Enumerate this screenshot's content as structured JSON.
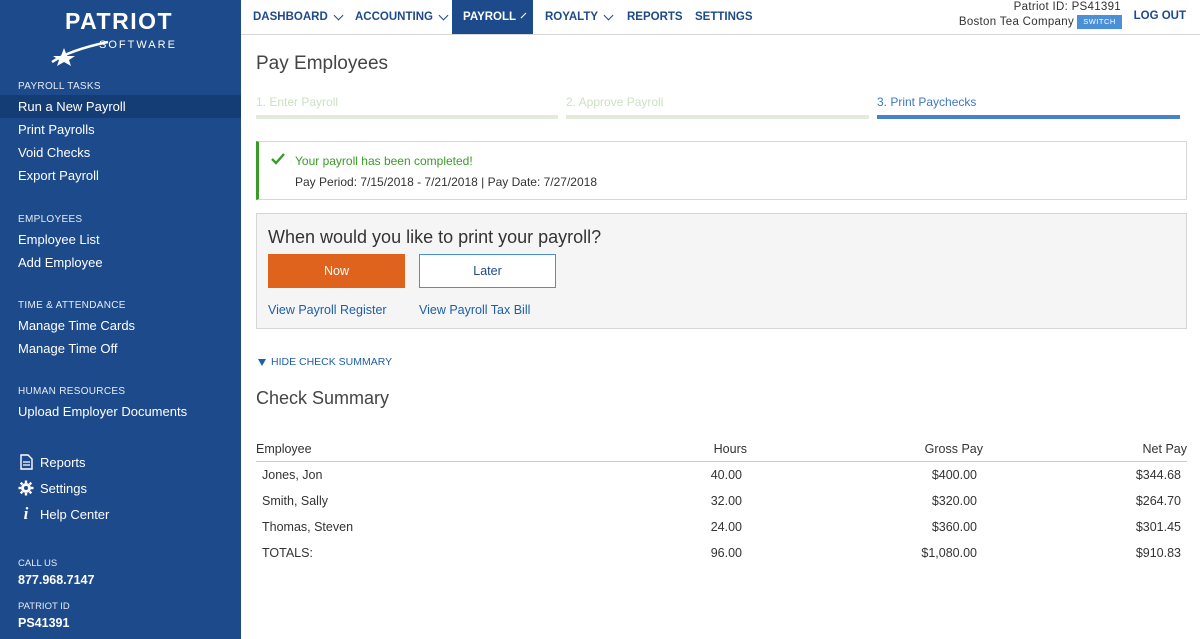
{
  "brand": {
    "name": "PATRIOT",
    "tagline": "SOFTWARE"
  },
  "sidebar": {
    "sections": [
      {
        "title": "PAYROLL TASKS",
        "items": [
          "Run a New Payroll",
          "Print Payrolls",
          "Void Checks",
          "Export Payroll"
        ]
      },
      {
        "title": "EMPLOYEES",
        "items": [
          "Employee List",
          "Add Employee"
        ]
      },
      {
        "title": "TIME & ATTENDANCE",
        "items": [
          "Manage Time Cards",
          "Manage Time Off"
        ]
      },
      {
        "title": "HUMAN RESOURCES",
        "items": [
          "Upload Employer Documents"
        ]
      }
    ],
    "active_item": "Run a New Payroll",
    "links": [
      {
        "label": "Reports",
        "icon": "document-icon"
      },
      {
        "label": "Settings",
        "icon": "gear-icon"
      },
      {
        "label": "Help Center",
        "icon": "info-icon"
      }
    ],
    "call_us_label": "CALL US",
    "phone": "877.968.7147",
    "patriot_id_label": "PATRIOT ID",
    "patriot_id": "PS41391"
  },
  "topnav": {
    "items": [
      {
        "label": "DASHBOARD",
        "dropdown": true
      },
      {
        "label": "ACCOUNTING",
        "dropdown": true
      },
      {
        "label": "PAYROLL",
        "dropdown": true,
        "active": true
      },
      {
        "label": "ROYALTY",
        "dropdown": true
      },
      {
        "label": "REPORTS",
        "dropdown": false
      },
      {
        "label": "SETTINGS",
        "dropdown": false
      }
    ],
    "patriot_id_text": "Patriot ID: PS41391",
    "company": "Boston Tea Company",
    "switch_label": "SWITCH",
    "logout_label": "LOG OUT"
  },
  "main": {
    "title": "Pay Employees",
    "steps": [
      {
        "label": "1. Enter Payroll",
        "state": "done"
      },
      {
        "label": "2. Approve Payroll",
        "state": "done"
      },
      {
        "label": "3. Print Paychecks",
        "state": "current"
      }
    ],
    "success": {
      "title": "Your payroll has been completed!",
      "detail": "Pay Period: 7/15/2018 - 7/21/2018 | Pay Date: 7/27/2018"
    },
    "print": {
      "question": "When would you like to print your payroll?",
      "now_label": "Now",
      "later_label": "Later",
      "register_link": "View Payroll Register",
      "tax_bill_link": "View Payroll Tax Bill"
    },
    "hide_summary_label": "HIDE CHECK SUMMARY",
    "summary_title": "Check Summary",
    "table": {
      "headers": [
        "Employee",
        "Hours",
        "Gross Pay",
        "Net Pay"
      ],
      "rows": [
        [
          "Jones, Jon",
          "40.00",
          "$400.00",
          "$344.68"
        ],
        [
          "Smith, Sally",
          "32.00",
          "$320.00",
          "$264.70"
        ],
        [
          "Thomas, Steven",
          "24.00",
          "$360.00",
          "$301.45"
        ],
        [
          "TOTALS:",
          "96.00",
          "$1,080.00",
          "$910.83"
        ]
      ]
    }
  },
  "colors": {
    "sidebar": "#1d4a8a",
    "accent_orange": "#e0631d",
    "success_green": "#3c9a2a",
    "link_blue": "#1d5fa8"
  }
}
